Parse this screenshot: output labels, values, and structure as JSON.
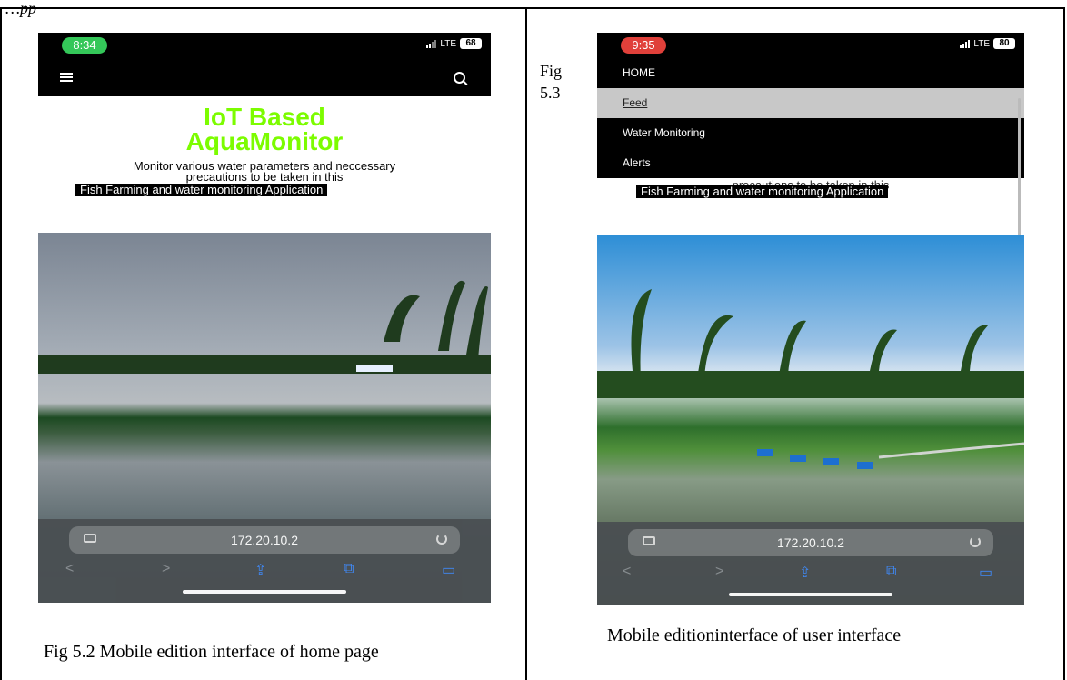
{
  "header_fragment": "…pp",
  "fig_side_label": [
    "Fig",
    "5.3"
  ],
  "left_phone": {
    "time": "8:34",
    "time_color": "#34c759",
    "network": "LTE",
    "battery": "68",
    "title_line1": "IoT Based",
    "title_line2": "AquaMonitor",
    "desc_line1": "Monitor various water parameters and neccessary",
    "desc_line2": "precautions to be taken in this",
    "banner": "Fish Farming and water monitoring Application",
    "url": "172.20.10.2",
    "icons": [
      "hamburger-icon",
      "search-icon",
      "tab-icon",
      "reload-icon",
      "back-icon",
      "forward-icon",
      "share-icon",
      "bookmarks-icon",
      "tabs-icon"
    ]
  },
  "right_phone": {
    "time": "9:35",
    "time_color": "#e0403a",
    "network": "LTE",
    "battery": "80",
    "menu": [
      "HOME",
      "Feed",
      "Water Monitoring",
      "Alerts"
    ],
    "active_menu": "Feed",
    "desc_partial": "precautions to be taken in this",
    "banner": "Fish Farming and water monitoring Application",
    "url": "172.20.10.2"
  },
  "captions": {
    "left": "Fig 5.2 Mobile edition interface of home page",
    "right": "Mobile editioninterface of user interface"
  }
}
